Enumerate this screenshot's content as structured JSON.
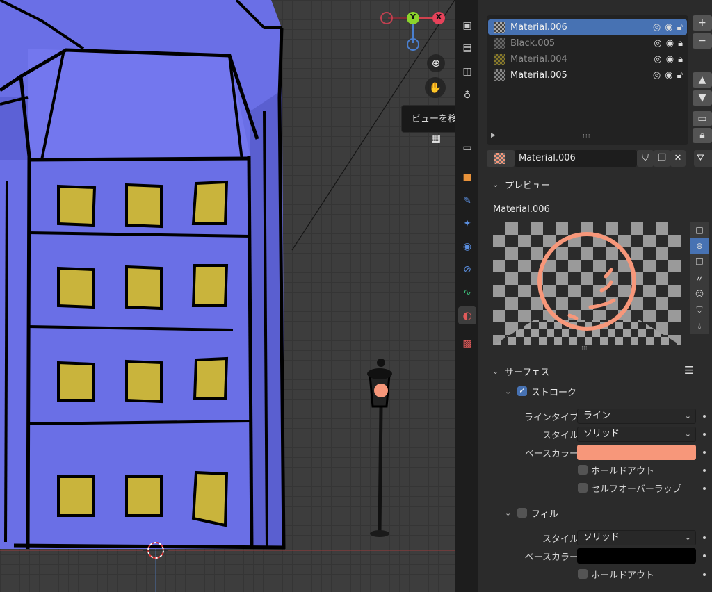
{
  "viewport": {
    "tooltip": "ビューを移動します",
    "gizmo": {
      "y_label": "Y",
      "x_label": "X"
    }
  },
  "tabs": [
    "render",
    "output",
    "view-layer",
    "scene",
    "world",
    "object",
    "modifiers",
    "particles",
    "physics",
    "constraints",
    "data",
    "material",
    "texture"
  ],
  "material_slots": [
    {
      "name": "Material.006",
      "active": true,
      "dim": false
    },
    {
      "name": "Black.005",
      "active": false,
      "dim": true
    },
    {
      "name": "Material.004",
      "active": false,
      "dim": true
    },
    {
      "name": "Material.005",
      "active": false,
      "dim": false
    }
  ],
  "material_name": "Material.006",
  "preview": {
    "header": "プレビュー",
    "title": "Material.006",
    "accent": "#f7977a"
  },
  "surface": {
    "header": "サーフェス",
    "stroke": {
      "label": "ストローク",
      "enabled": true,
      "line_type_label": "ラインタイプ",
      "line_type": "ライン",
      "style_label": "スタイル",
      "style": "ソリッド",
      "base_color_label": "ベースカラー",
      "base_color": "#f7977a",
      "holdout": "ホールドアウト",
      "self_overlap": "セルフオーバーラップ"
    },
    "fill": {
      "label": "フィル",
      "enabled": false,
      "style_label": "スタイル",
      "style": "ソリッド",
      "base_color_label": "ベースカラー",
      "base_color": "#000000",
      "holdout": "ホールドアウト"
    }
  }
}
